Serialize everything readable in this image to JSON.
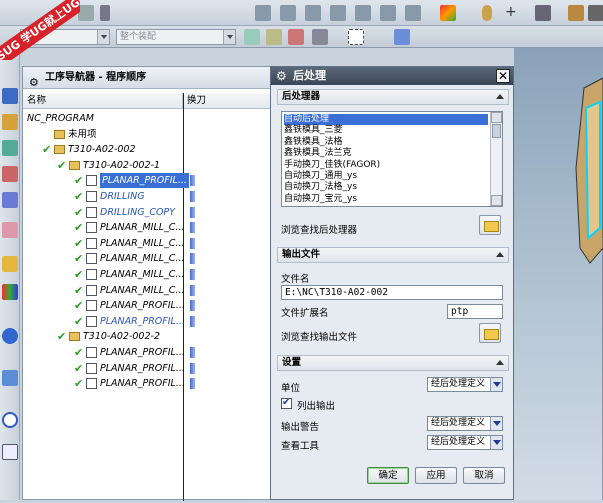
{
  "watermark": {
    "line1": "9SUG",
    "line2": "学UG就上UG网"
  },
  "toolbar": {
    "combo1": "",
    "combo2": "整个装配"
  },
  "navigator": {
    "title": "工序导航器 - 程序顺序",
    "columns": [
      "名称",
      "换刀"
    ],
    "rows": [
      {
        "label": "NC_PROGRAM",
        "indent": 0,
        "type": "root"
      },
      {
        "label": "未用项",
        "indent": 1,
        "type": "folder"
      },
      {
        "label": "T310-A02-002",
        "indent": 1,
        "type": "program"
      },
      {
        "label": "T310-A02-002-1",
        "indent": 2,
        "type": "program"
      },
      {
        "label": "PLANAR_PROFIL...",
        "indent": 3,
        "type": "op",
        "selected": true
      },
      {
        "label": "DRILLING",
        "indent": 3,
        "type": "op"
      },
      {
        "label": "DRILLING_COPY",
        "indent": 3,
        "type": "op"
      },
      {
        "label": "PLANAR_MILL_C...",
        "indent": 3,
        "type": "op"
      },
      {
        "label": "PLANAR_MILL_C...",
        "indent": 3,
        "type": "op"
      },
      {
        "label": "PLANAR_MILL_C...",
        "indent": 3,
        "type": "op"
      },
      {
        "label": "PLANAR_MILL_C...",
        "indent": 3,
        "type": "op"
      },
      {
        "label": "PLANAR_MILL_C...",
        "indent": 3,
        "type": "op"
      },
      {
        "label": "PLANAR_PROFIL...",
        "indent": 3,
        "type": "op"
      },
      {
        "label": "PLANAR_PROFIL...",
        "indent": 3,
        "type": "op"
      },
      {
        "label": "T310-A02-002-2",
        "indent": 2,
        "type": "program"
      },
      {
        "label": "PLANAR_PROFIL...",
        "indent": 3,
        "type": "op"
      },
      {
        "label": "PLANAR_PROFIL...",
        "indent": 3,
        "type": "op"
      },
      {
        "label": "PLANAR_PROFIL...",
        "indent": 3,
        "type": "op"
      }
    ]
  },
  "dialog": {
    "title": "后处理",
    "close": "✕",
    "postprocessor": {
      "header": "后处理器",
      "items": [
        "自动后处理",
        "鑫铁模具_三菱",
        "鑫铁模具_法格",
        "鑫铁模具_法兰克",
        "手动换刀_佳铁(FAGOR)",
        "自动换刀_通用_ys",
        "自动换刀_法格_ys",
        "自动换刀_宝元_ys"
      ],
      "selected_index": 0,
      "browse_label": "浏览查找后处理器"
    },
    "output": {
      "header": "输出文件",
      "filename_label": "文件名",
      "filename_value": "E:\\NC\\T310-A02-002",
      "ext_label": "文件扩展名",
      "ext_value": "ptp",
      "browse_label": "浏览查找输出文件"
    },
    "settings": {
      "header": "设置",
      "units_label": "单位",
      "units_value": "经后处理定义",
      "list_output_label": "列出输出",
      "list_output_checked": true,
      "warnings_label": "输出警告",
      "warnings_value": "经后处理定义",
      "review_label": "查看工具",
      "review_value": "经后处理定义"
    },
    "buttons": {
      "ok": "确定",
      "apply": "应用",
      "cancel": "取消"
    }
  }
}
